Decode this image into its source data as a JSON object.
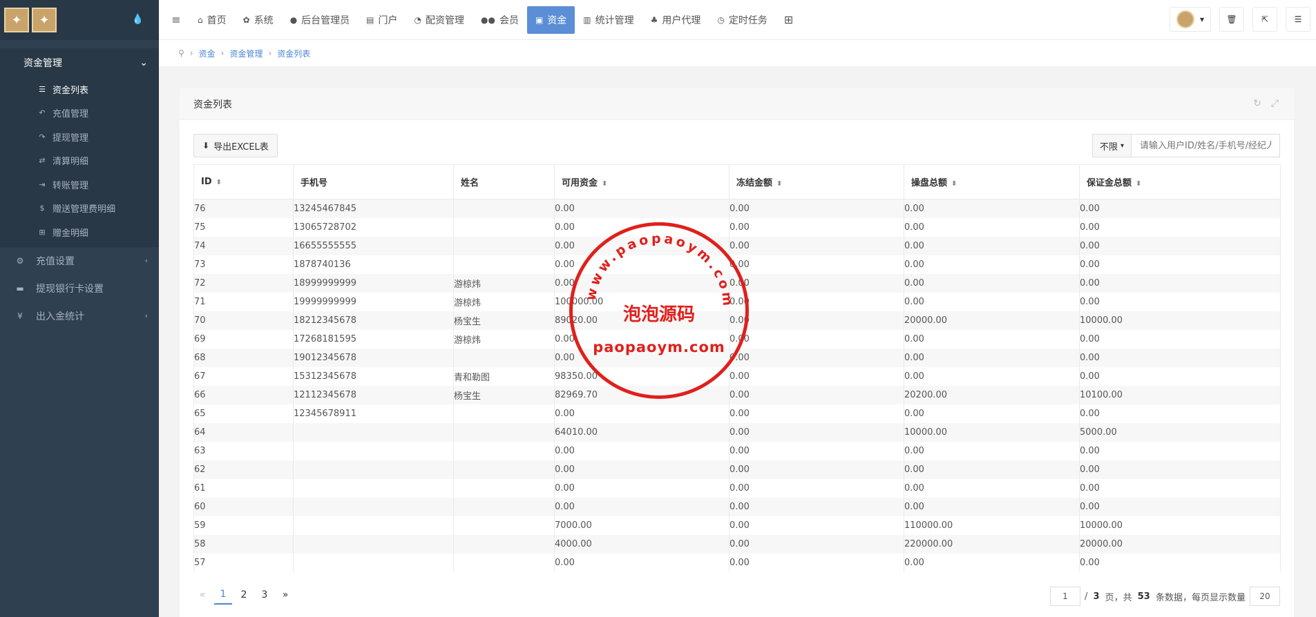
{
  "sidebar": {
    "group_title": "资金管理",
    "sub_items": [
      {
        "label": "资金列表",
        "icon": "list-icon",
        "glyph": "☰"
      },
      {
        "label": "充值管理",
        "icon": "reply-icon",
        "glyph": "↶"
      },
      {
        "label": "提现管理",
        "icon": "share-icon",
        "glyph": "↷"
      },
      {
        "label": "清算明细",
        "icon": "shuffle-icon",
        "glyph": "⇄"
      },
      {
        "label": "转账管理",
        "icon": "transfer-icon",
        "glyph": "⇥"
      },
      {
        "label": "赠送管理费明细",
        "icon": "dollar-icon",
        "glyph": "$"
      },
      {
        "label": "赠金明细",
        "icon": "plus-square-icon",
        "glyph": "⊞"
      }
    ],
    "items": [
      {
        "label": "充值设置",
        "icon": "gear-icon",
        "glyph": "⚙"
      },
      {
        "label": "提现银行卡设置",
        "icon": "card-icon",
        "glyph": "▬"
      },
      {
        "label": "出入金统计",
        "icon": "yen-icon",
        "glyph": "¥"
      }
    ]
  },
  "topnav": {
    "items": [
      {
        "label": "首页",
        "icon": "home-icon",
        "glyph": "⌂"
      },
      {
        "label": "系统",
        "icon": "cog-icon",
        "glyph": "✿"
      },
      {
        "label": "后台管理员",
        "icon": "user-icon",
        "glyph": "●"
      },
      {
        "label": "门户",
        "icon": "newspaper-icon",
        "glyph": "▤"
      },
      {
        "label": "配资管理",
        "icon": "pie-chart-icon",
        "glyph": "◔"
      },
      {
        "label": "会员",
        "icon": "users-icon",
        "glyph": "●●"
      },
      {
        "label": "资金",
        "icon": "money-icon",
        "glyph": "▣"
      },
      {
        "label": "统计管理",
        "icon": "bar-chart-icon",
        "glyph": "▥"
      },
      {
        "label": "用户代理",
        "icon": "sitemap-icon",
        "glyph": "♣"
      },
      {
        "label": "定时任务",
        "icon": "clock-icon",
        "glyph": "◷"
      }
    ],
    "active_index": 6
  },
  "breadcrumb": [
    "资金",
    "资金管理",
    "资金列表"
  ],
  "panel": {
    "title": "资金列表",
    "export_label": "导出EXCEL表",
    "filter_label": "不限",
    "search_placeholder": "请输入用户ID/姓名/手机号/经纪人"
  },
  "table": {
    "columns": [
      "ID",
      "手机号",
      "姓名",
      "可用资金",
      "冻结金额",
      "操盘总额",
      "保证金总额"
    ],
    "rows": [
      [
        "76",
        "13245467845",
        "",
        "0.00",
        "0.00",
        "0.00",
        "0.00"
      ],
      [
        "75",
        "13065728702",
        "",
        "0.00",
        "0.00",
        "0.00",
        "0.00"
      ],
      [
        "74",
        "16655555555",
        "",
        "0.00",
        "0.00",
        "0.00",
        "0.00"
      ],
      [
        "73",
        "1878740136",
        "",
        "0.00",
        "0.00",
        "0.00",
        "0.00"
      ],
      [
        "72",
        "18999999999",
        "游椋炜",
        "0.00",
        "0.00",
        "0.00",
        "0.00"
      ],
      [
        "71",
        "19999999999",
        "游椋炜",
        "100000.00",
        "0.00",
        "0.00",
        "0.00"
      ],
      [
        "70",
        "18212345678",
        "杨宝生",
        "89020.00",
        "0.00",
        "20000.00",
        "10000.00"
      ],
      [
        "69",
        "17268181595",
        "游椋炜",
        "0.00",
        "0.00",
        "0.00",
        "0.00"
      ],
      [
        "68",
        "19012345678",
        "",
        "0.00",
        "0.00",
        "0.00",
        "0.00"
      ],
      [
        "67",
        "15312345678",
        "青和勒图",
        "98350.00",
        "0.00",
        "0.00",
        "0.00"
      ],
      [
        "66",
        "12112345678",
        "杨宝生",
        "82969.70",
        "0.00",
        "20200.00",
        "10100.00"
      ],
      [
        "65",
        "12345678911",
        "",
        "0.00",
        "0.00",
        "0.00",
        "0.00"
      ],
      [
        "64",
        "",
        "",
        "64010.00",
        "0.00",
        "10000.00",
        "5000.00"
      ],
      [
        "63",
        "",
        "",
        "0.00",
        "0.00",
        "0.00",
        "0.00"
      ],
      [
        "62",
        "",
        "",
        "0.00",
        "0.00",
        "0.00",
        "0.00"
      ],
      [
        "61",
        "",
        "",
        "0.00",
        "0.00",
        "0.00",
        "0.00"
      ],
      [
        "60",
        "",
        "",
        "0.00",
        "0.00",
        "0.00",
        "0.00"
      ],
      [
        "59",
        "",
        "",
        "7000.00",
        "0.00",
        "110000.00",
        "10000.00"
      ],
      [
        "58",
        "",
        "",
        "4000.00",
        "0.00",
        "220000.00",
        "20000.00"
      ],
      [
        "57",
        "",
        "",
        "0.00",
        "0.00",
        "0.00",
        "0.00"
      ]
    ]
  },
  "pagination": {
    "prev": "«",
    "next": "»",
    "pages": [
      "1",
      "2",
      "3"
    ],
    "current": "1",
    "page_input": "1",
    "total_pages_text": "/ ",
    "total_pages": "3",
    "text_mid": " 页，共 ",
    "total_records": "53",
    "text_end": " 条数据，每页显示数量",
    "page_size": "20"
  },
  "watermark": {
    "arc_text": "www.paopaoym.com",
    "cn_text": "泡泡源码",
    "url_text": "paopaoym.com",
    "color": "#e0201c"
  }
}
